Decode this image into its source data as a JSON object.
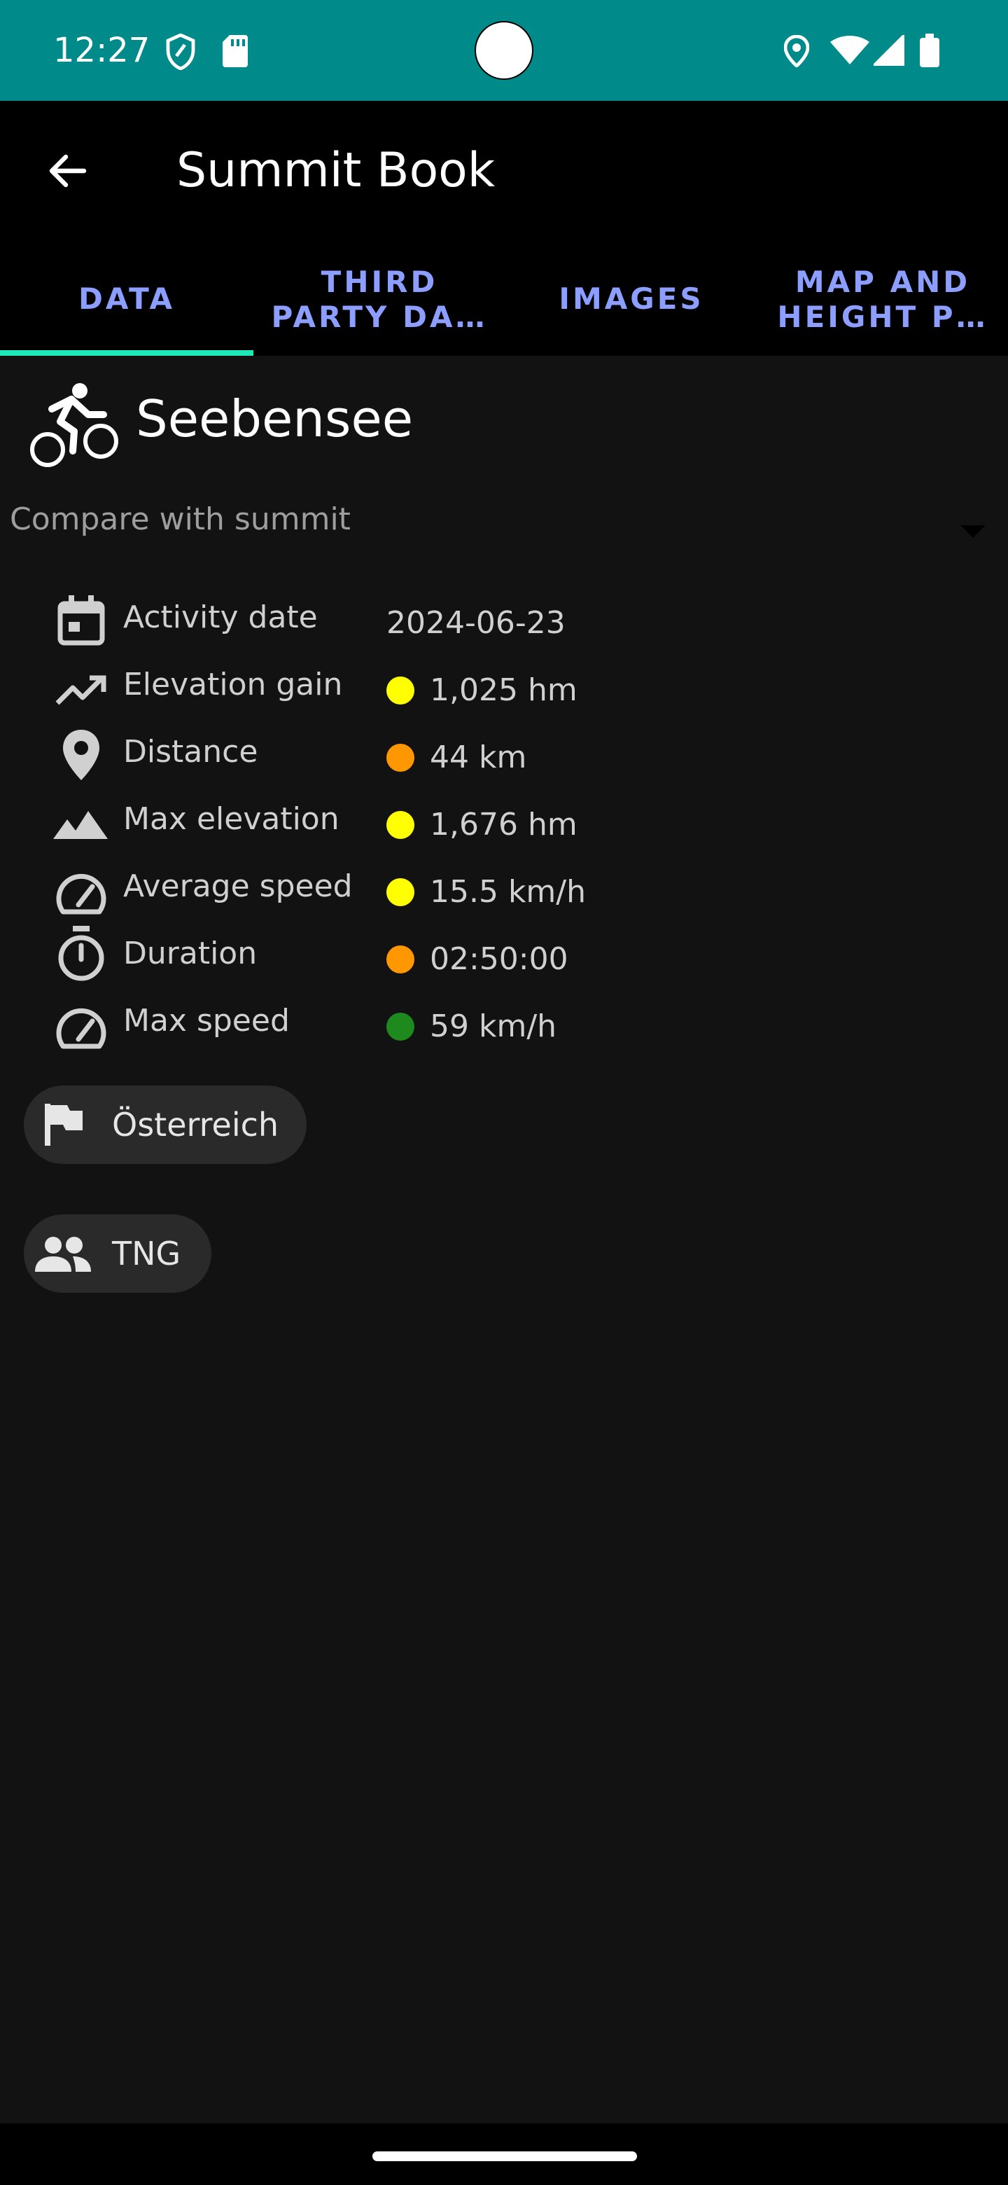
{
  "status_bar": {
    "time": "12:27",
    "icons": [
      "shield-icon",
      "sd-card-icon",
      "location-icon",
      "wifi-icon",
      "signal-icon",
      "battery-icon"
    ]
  },
  "toolbar": {
    "title": "Summit Book",
    "back_icon": "arrow-back-icon"
  },
  "tabs": [
    {
      "label": "DATA",
      "selected": true
    },
    {
      "label_line1": "THIRD",
      "label_line2": "PARTY DA…"
    },
    {
      "label": "IMAGES"
    },
    {
      "label_line1": "MAP AND",
      "label_line2": "HEIGHT P…"
    }
  ],
  "activity": {
    "name": "Seebensee",
    "type_icon": "bike-icon"
  },
  "compare": {
    "label": "Compare with summit"
  },
  "details": [
    {
      "label": "Activity date",
      "value": "2024-06-23",
      "icon": "calendar-icon"
    },
    {
      "label": "Elevation gain",
      "value": "1,025 hm",
      "icon": "trending-up-icon",
      "dot_color": "#ffff00"
    },
    {
      "label": "Distance",
      "value": "44 km",
      "icon": "location-pin-icon",
      "dot_color": "#ff9800"
    },
    {
      "label": "Max elevation",
      "value": "1,676 hm",
      "icon": "mountain-icon",
      "dot_color": "#ffff00"
    },
    {
      "label": "Average speed",
      "value": "15.5 km/h",
      "icon": "speedometer-icon",
      "dot_color": "#ffff00"
    },
    {
      "label": "Duration",
      "value": "02:50:00",
      "icon": "stopwatch-icon",
      "dot_color": "#ff9800"
    },
    {
      "label": "Max speed",
      "value": "59 km/h",
      "icon": "speedometer-icon",
      "dot_color": "#1e8a1e"
    }
  ],
  "chips": [
    {
      "label": "Österreich",
      "icon": "flag-icon"
    },
    {
      "label": "TNG",
      "icon": "people-icon"
    }
  ],
  "colors": {
    "status_bar": "#008a8a",
    "accent": "#1de9b6",
    "tab_text": "#8c9eff",
    "background": "#121212"
  }
}
